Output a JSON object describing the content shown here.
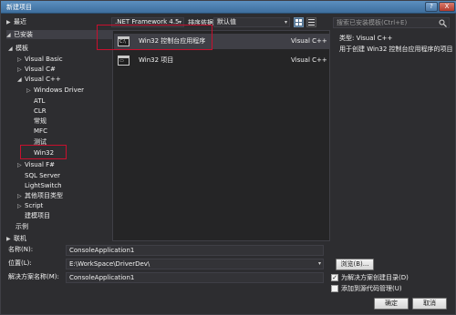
{
  "window": {
    "title": "新建项目",
    "help_label": "?",
    "close_label": "X"
  },
  "tree": {
    "recent": {
      "label": "最近",
      "arrow": "▶"
    },
    "installed": {
      "label": "已安装",
      "arrow": "◢"
    },
    "templates": {
      "label": "模板",
      "arrow": "◢"
    },
    "items": [
      {
        "label": "Visual Basic",
        "arrow": "▷"
      },
      {
        "label": "Visual C#",
        "arrow": "▷"
      },
      {
        "label": "Visual C++",
        "arrow": "◢"
      },
      {
        "label": "Windows Driver",
        "arrow": "▷"
      },
      {
        "label": "ATL",
        "arrow": ""
      },
      {
        "label": "CLR",
        "arrow": ""
      },
      {
        "label": "常规",
        "arrow": ""
      },
      {
        "label": "MFC",
        "arrow": ""
      },
      {
        "label": "测试",
        "arrow": ""
      },
      {
        "label": "Win32",
        "arrow": ""
      },
      {
        "label": "Visual F#",
        "arrow": "▷"
      },
      {
        "label": "SQL Server",
        "arrow": ""
      },
      {
        "label": "LightSwitch",
        "arrow": ""
      },
      {
        "label": "其他项目类型",
        "arrow": "▷"
      },
      {
        "label": "Script",
        "arrow": "▷"
      },
      {
        "label": "建模项目",
        "arrow": ""
      },
      {
        "label": "示例",
        "arrow": ""
      }
    ],
    "online": {
      "label": "联机",
      "arrow": "▶"
    }
  },
  "toolbar": {
    "framework": ".NET Framework 4.5",
    "sort_label": "排序依据:",
    "sort_value": "默认值",
    "chevron": "▾"
  },
  "search": {
    "placeholder": "搜索已安装模板(Ctrl+E)"
  },
  "templates": [
    {
      "name": "Win32 控制台应用程序",
      "lang": "Visual C++",
      "glyph": "C:\\"
    },
    {
      "name": "Win32 项目",
      "lang": "Visual C++",
      "glyph": "▭"
    }
  ],
  "description": {
    "type": "类型: Visual C++",
    "text": "用于创建 Win32 控制台应用程序的项目"
  },
  "form": {
    "name_label": "名称(N):",
    "name_value": "ConsoleApplication1",
    "location_label": "位置(L):",
    "location_value": "E:\\WorkSpace\\DriverDev\\",
    "solution_label": "解决方案名称(M):",
    "solution_value": "ConsoleApplication1",
    "browse_label": "浏览(B)...",
    "create_dir_label": "为解决方案创建目录(D)",
    "create_dir_checked": "✓",
    "source_control_label": "添加到源代码管理(U)",
    "ok_label": "确定",
    "cancel_label": "取消"
  },
  "colors": {
    "accent_red": "#c8102e",
    "bg": "#2d2d30",
    "pane": "#252526"
  }
}
